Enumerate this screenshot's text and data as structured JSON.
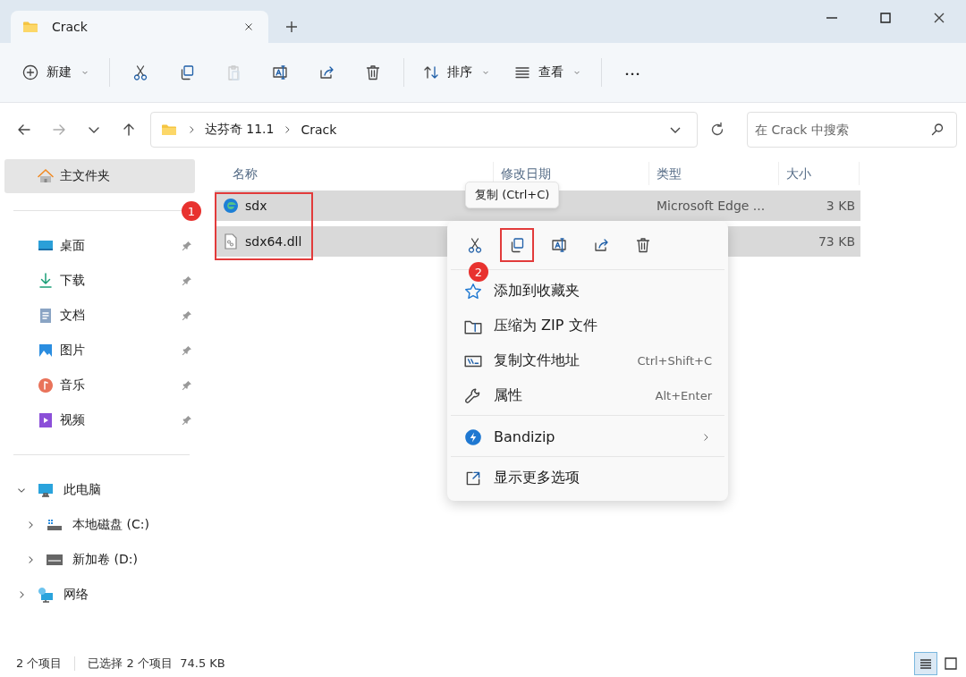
{
  "window": {
    "tab_title": "Crack"
  },
  "toolbar": [
    {
      "kind": "new",
      "label": "新建",
      "disabled": false
    },
    {
      "kind": "cut",
      "disabled": false
    },
    {
      "kind": "copy",
      "disabled": false
    },
    {
      "kind": "paste",
      "disabled": true
    },
    {
      "kind": "rename",
      "disabled": false
    },
    {
      "kind": "share",
      "disabled": false
    },
    {
      "kind": "delete",
      "disabled": false
    },
    {
      "kind": "sort",
      "label": "排序",
      "disabled": false
    },
    {
      "kind": "view",
      "label": "查看",
      "disabled": false
    },
    {
      "kind": "more",
      "disabled": false
    }
  ],
  "address": {
    "path": [
      "达芬奇 11.1",
      "Crack"
    ],
    "search_placeholder": "在 Crack 中搜索"
  },
  "sidebar": {
    "home": {
      "label": "主文件夹",
      "selected": true
    },
    "quick_access": [
      {
        "kind": "desktop",
        "label": "桌面"
      },
      {
        "kind": "download",
        "label": "下载"
      },
      {
        "kind": "documents",
        "label": "文档"
      },
      {
        "kind": "pictures",
        "label": "图片"
      },
      {
        "kind": "music",
        "label": "音乐"
      },
      {
        "kind": "videos",
        "label": "视频"
      }
    ],
    "tree": [
      {
        "kind": "pc",
        "label": "此电脑",
        "expanded": true,
        "children": [
          {
            "kind": "drive-c",
            "label": "本地磁盘 (C:)",
            "expanded": false
          },
          {
            "kind": "drive",
            "label": "新加卷 (D:)",
            "expanded": false
          }
        ]
      },
      {
        "kind": "network",
        "label": "网络",
        "expanded": false
      }
    ]
  },
  "file_list": {
    "columns": [
      "名称",
      "修改日期",
      "类型",
      "大小"
    ],
    "rows": [
      {
        "kind": "edge",
        "name": "sdx",
        "type": "Microsoft Edge ...",
        "size": "3 KB",
        "selected": true
      },
      {
        "kind": "dll",
        "name": "sdx64.dll",
        "size": "73 KB",
        "selected": true
      }
    ]
  },
  "tooltip": "复制 (Ctrl+C)",
  "context_menu": {
    "actions": [
      {
        "kind": "cut",
        "highlighted": false
      },
      {
        "kind": "copy",
        "highlighted": true
      },
      {
        "kind": "rename",
        "highlighted": false
      },
      {
        "kind": "share",
        "highlighted": false
      },
      {
        "kind": "delete",
        "highlighted": false
      }
    ],
    "groups": [
      [
        {
          "kind": "star",
          "label": "添加到收藏夹"
        },
        {
          "kind": "zip",
          "label": "压缩为 ZIP 文件"
        },
        {
          "kind": "path",
          "label": "复制文件地址",
          "shortcut": "Ctrl+Shift+C"
        },
        {
          "kind": "wrench",
          "label": "属性",
          "shortcut": "Alt+Enter"
        }
      ],
      [
        {
          "kind": "bandizip",
          "label": "Bandizip",
          "submenu": true
        }
      ],
      [
        {
          "kind": "expand",
          "label": "显示更多选项"
        }
      ]
    ]
  },
  "annotations": [
    "1",
    "2"
  ],
  "status_bar": {
    "count": "2 个项目",
    "selection": "已选择 2 个项目  74.5 KB",
    "views": [
      {
        "kind": "details",
        "selected": true
      },
      {
        "kind": "tiles",
        "selected": false
      }
    ]
  }
}
